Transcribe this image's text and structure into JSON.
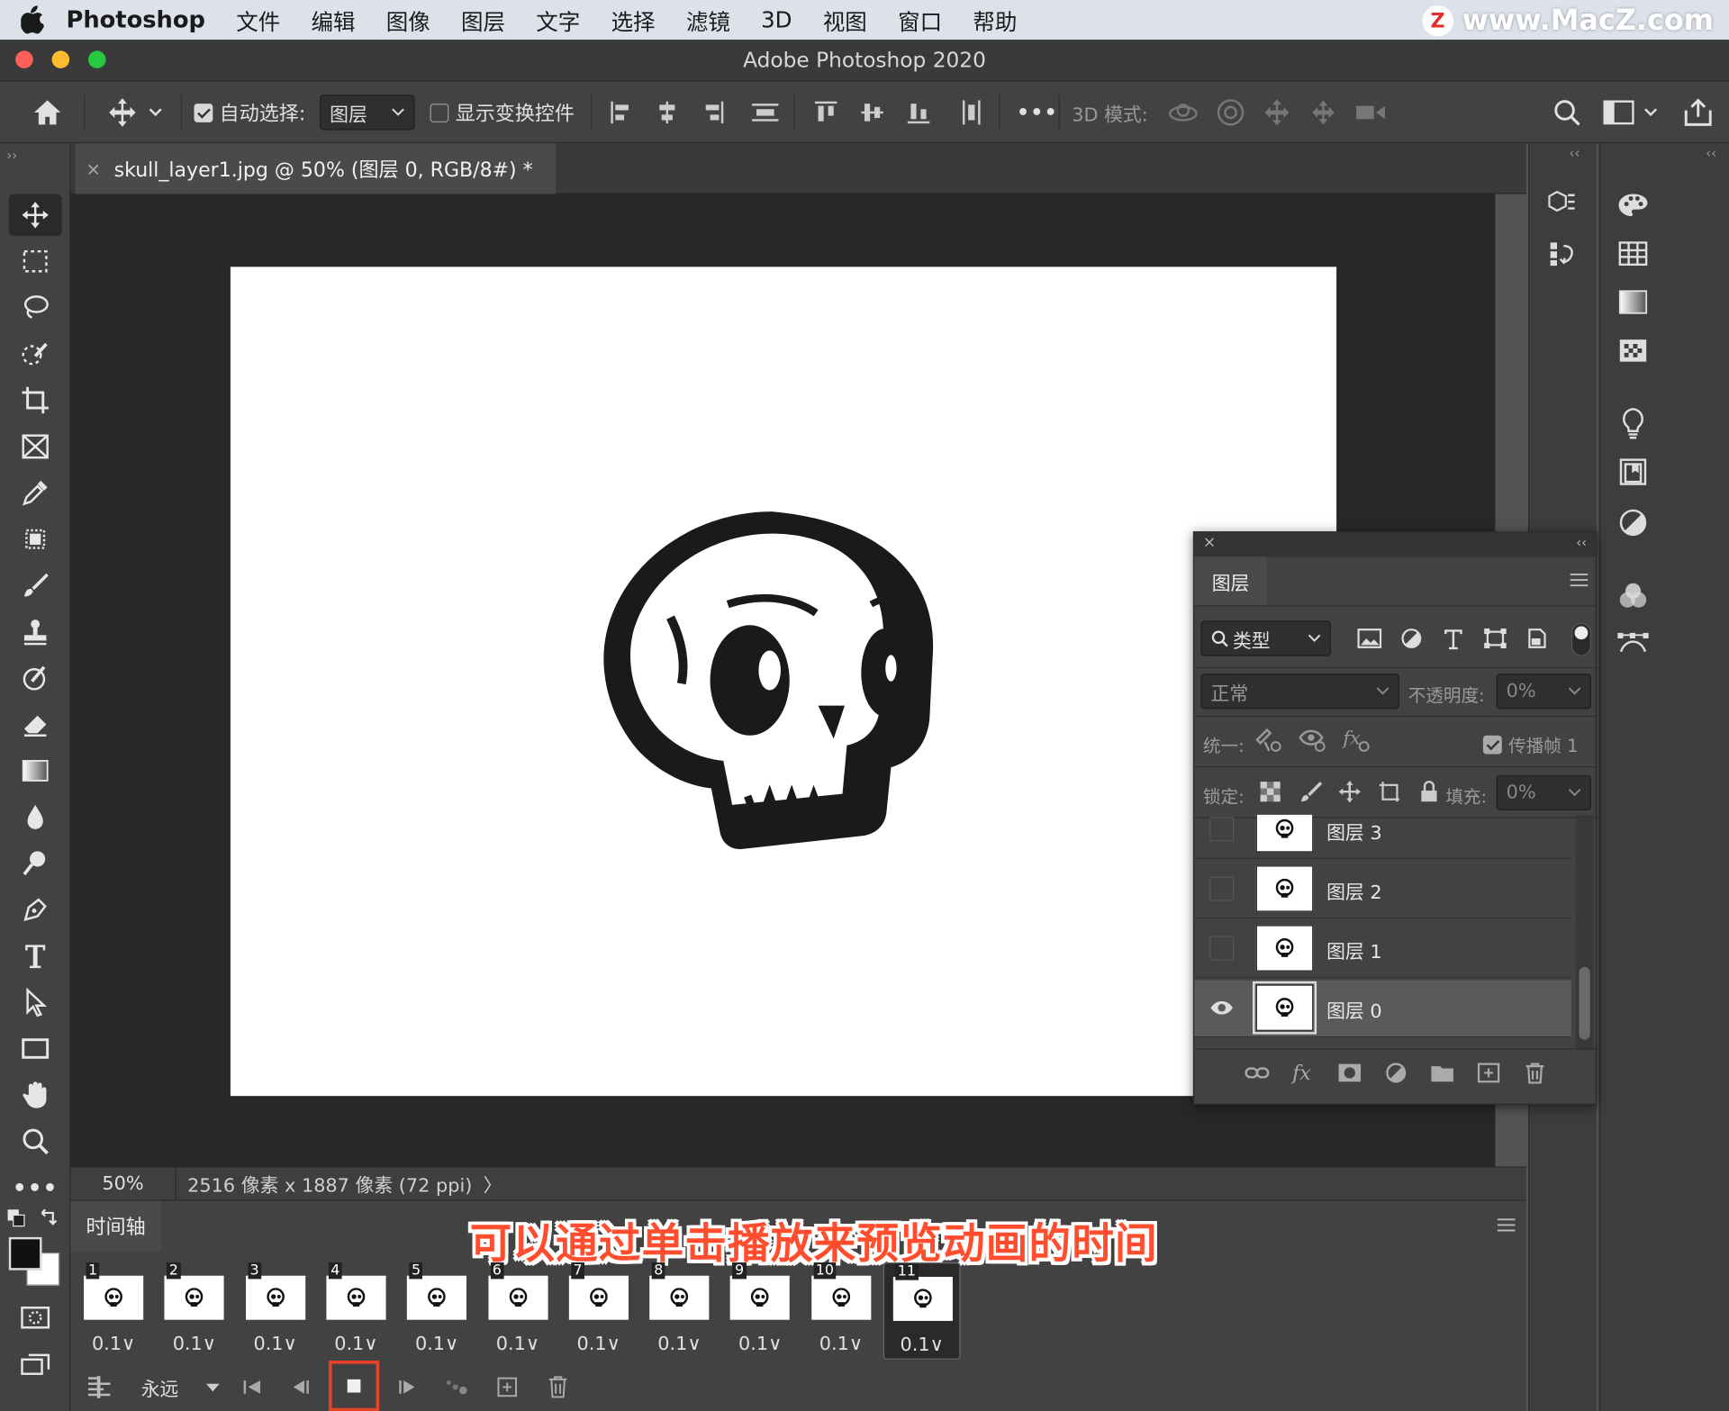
{
  "menubar": {
    "app": "Photoshop",
    "items": [
      "文件",
      "编辑",
      "图像",
      "图层",
      "文字",
      "选择",
      "滤镜",
      "3D",
      "视图",
      "窗口",
      "帮助"
    ]
  },
  "watermark": {
    "text": "www.MacZ.com",
    "logo": "Z"
  },
  "window": {
    "title": "Adobe Photoshop 2020"
  },
  "options": {
    "auto_select_label": "自动选择:",
    "auto_select_checked": true,
    "auto_select_target": "图层",
    "show_transform_label": "显示变换控件",
    "show_transform_checked": false,
    "more": "•••",
    "mode3d_label": "3D 模式:"
  },
  "document": {
    "tab_title": "skull_layer1.jpg @ 50% (图层 0, RGB/8#) *",
    "close": "×"
  },
  "status": {
    "zoom": "50%",
    "info": "2516 像素 x 1887 像素 (72 ppi)",
    "arrow": "〉"
  },
  "timeline": {
    "tab": "时间轴",
    "caption": "可以通过单击播放来预览动画的时间",
    "loop": "永远",
    "selected_frame": 11,
    "frames": [
      {
        "n": "1",
        "delay": "0.1∨"
      },
      {
        "n": "2",
        "delay": "0.1∨"
      },
      {
        "n": "3",
        "delay": "0.1∨"
      },
      {
        "n": "4",
        "delay": "0.1∨"
      },
      {
        "n": "5",
        "delay": "0.1∨"
      },
      {
        "n": "6",
        "delay": "0.1∨"
      },
      {
        "n": "7",
        "delay": "0.1∨"
      },
      {
        "n": "8",
        "delay": "0.1∨"
      },
      {
        "n": "9",
        "delay": "0.1∨"
      },
      {
        "n": "10",
        "delay": "0.1∨"
      },
      {
        "n": "11",
        "delay": "0.1∨"
      }
    ]
  },
  "layers_panel": {
    "tab": "图层",
    "filter_kind": "类型",
    "blend_mode": "正常",
    "opacity_label": "不透明度:",
    "opacity": "0%",
    "unify_label": "统一:",
    "propagate_label": "传播帧 1",
    "propagate_checked": true,
    "lock_label": "锁定:",
    "fill_label": "填充:",
    "fill": "0%",
    "layers": [
      {
        "name": "图层 3",
        "visible": false,
        "active": false
      },
      {
        "name": "图层 2",
        "visible": false,
        "active": false
      },
      {
        "name": "图层 1",
        "visible": false,
        "active": false
      },
      {
        "name": "图层 0",
        "visible": true,
        "active": true
      }
    ]
  },
  "colors": {
    "accent_red": "#e5432a",
    "caption_red": "#ff4d2e",
    "panel_bg": "#424242",
    "canvas_bg": "#282828"
  }
}
